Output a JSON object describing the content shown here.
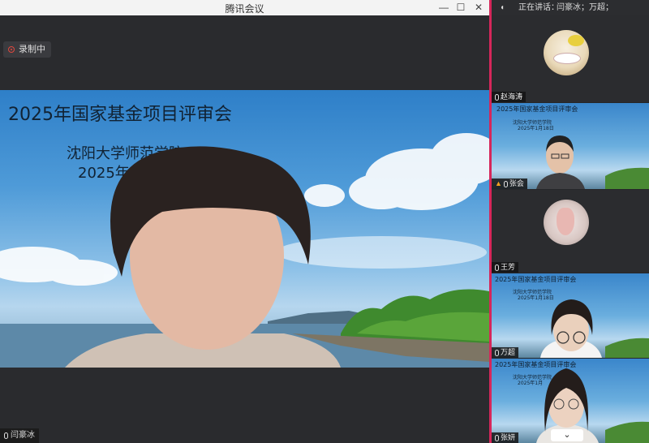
{
  "window": {
    "title": "腾讯会议",
    "minimize": "—",
    "maximize": "☐",
    "close": "✕"
  },
  "recording": {
    "label": "录制中"
  },
  "main_video": {
    "slide_title": "2025年国家基金项目评审会",
    "slide_org": "沈阳大学师范学院",
    "slide_date": "2025年1月",
    "speaker_name": "闫豪冰"
  },
  "side_panel": {
    "speaking_label": "正在讲话：",
    "speaking_names": "闫豪冰；万超；",
    "participants": [
      {
        "name": "赵海涛"
      },
      {
        "name": "张会",
        "slide_title": "2025年国家基金项目评审会",
        "slide_org": "沈阳大学师范学院",
        "slide_date": "2025年1月18日"
      },
      {
        "name": "王芳"
      },
      {
        "name": "万超",
        "slide_title": "2025年国家基金项目评审会",
        "slide_org": "沈阳大学师范学院",
        "slide_date": "2025年1月18日"
      },
      {
        "name": "张妍",
        "slide_title": "2025年国家基金项目评审会",
        "slide_org": "沈阳大学师范学院",
        "slide_date": "2025年1月"
      }
    ]
  },
  "colors": {
    "accent_divider": "#d6265a",
    "record_red": "#e0473f"
  },
  "icons": [
    "record-icon",
    "mic-icon",
    "speaker-icon",
    "chevron-down-icon"
  ]
}
